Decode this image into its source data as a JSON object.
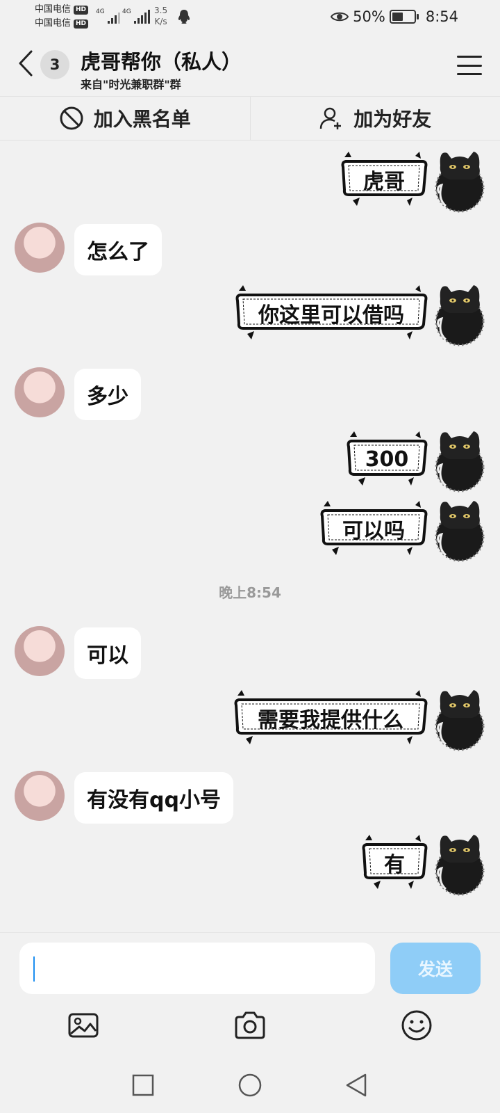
{
  "status_bar": {
    "carrier_1": "中国电信",
    "carrier_2": "中国电信",
    "hd_1": "HD",
    "hd_2": "HD",
    "net_1": "4G",
    "net_2": "4G",
    "net_speed_value": "3.5",
    "net_speed_unit": "K/s",
    "battery_percent": "50%",
    "battery_level": 0.5,
    "time": "8:54"
  },
  "header": {
    "unread_count": "3",
    "title": "虎哥帮你（私人）",
    "subtitle": "来自\"时光兼职群\"群"
  },
  "actions": {
    "block_label": "加入黑名单",
    "add_friend_label": "加为好友"
  },
  "messages": [
    {
      "side": "out",
      "type": "sticker",
      "text": "虎哥"
    },
    {
      "side": "in",
      "type": "text",
      "text": "怎么了"
    },
    {
      "side": "out",
      "type": "sticker",
      "text": "你这里可以借吗"
    },
    {
      "side": "in",
      "type": "text",
      "text": "多少"
    },
    {
      "side": "out",
      "type": "sticker",
      "text": "300"
    },
    {
      "side": "out",
      "type": "sticker",
      "text": "可以吗"
    },
    {
      "side": "system",
      "type": "timestamp",
      "text": "晚上8:54"
    },
    {
      "side": "in",
      "type": "text",
      "text": "可以"
    },
    {
      "side": "out",
      "type": "sticker",
      "text": "需要我提供什么"
    },
    {
      "side": "in",
      "type": "text",
      "text": "有没有qq小号"
    },
    {
      "side": "out",
      "type": "sticker",
      "text": "有"
    }
  ],
  "composer": {
    "input_value": "",
    "send_label": "发送"
  },
  "colors": {
    "background": "#f1f1f1",
    "send_button": "#8fcdf7",
    "caret": "#1b8ef0"
  },
  "icons": {
    "back": "chevron-left-icon",
    "menu": "hamburger-menu-icon",
    "block": "block-icon",
    "add_friend": "add-user-icon",
    "image": "image-icon",
    "camera": "camera-icon",
    "emoji": "emoji-icon"
  }
}
